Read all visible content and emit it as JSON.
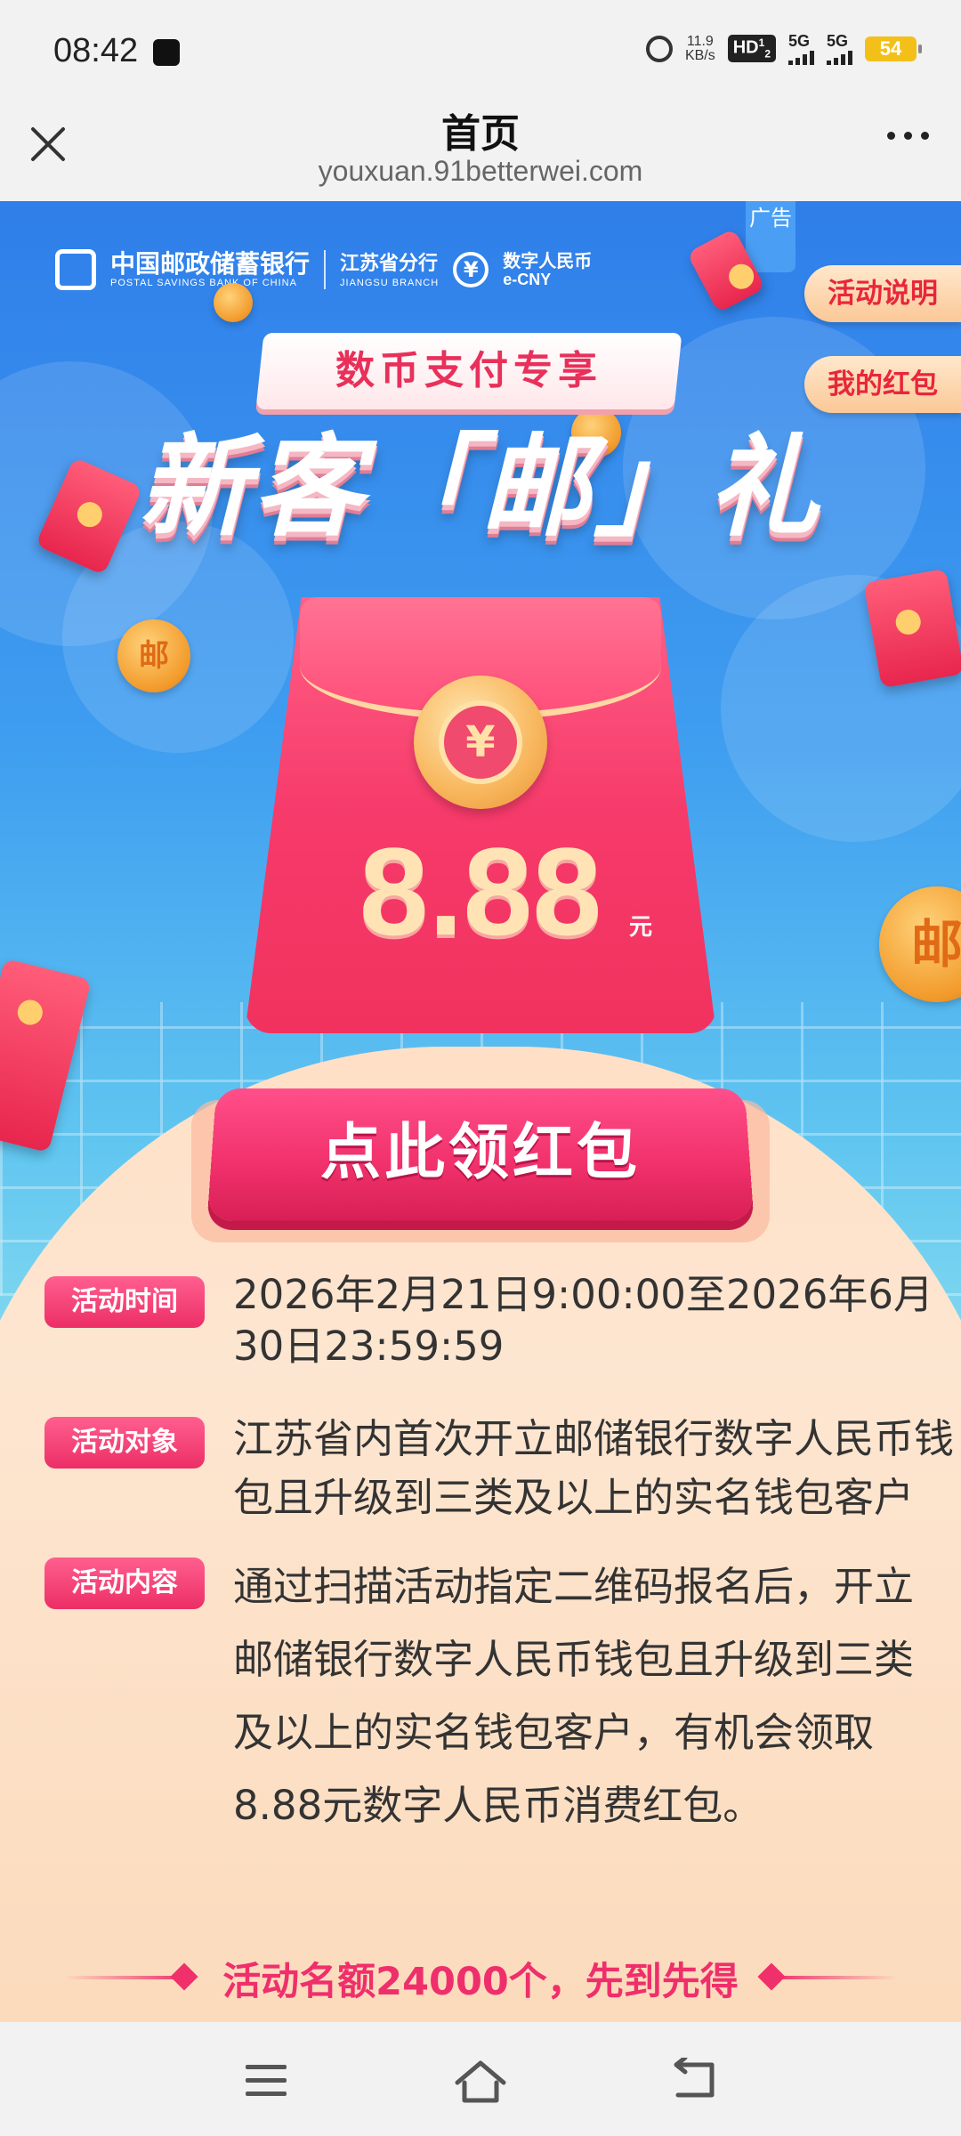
{
  "status_bar": {
    "time": "08:42",
    "net_speed_value": "11.9",
    "net_speed_unit": "KB/s",
    "hd_badge": "HD",
    "hd_sub": "1",
    "hd_sub2": "2",
    "signal1": "5G",
    "signal2": "5G",
    "battery": "54"
  },
  "header": {
    "title": "首页",
    "url": "youxuan.91betterwei.com"
  },
  "ad": {
    "ad_tag": "广告",
    "bank_name": "中国邮政储蓄银行",
    "bank_name_en": "POSTAL SAVINGS BANK OF CHINA",
    "branch": "江苏省分行",
    "branch_en": "JIANGSU BRANCH",
    "ecny_label": "数字人民币",
    "ecny_en": "e-CNY",
    "side_buttons": [
      "活动说明",
      "我的红包"
    ],
    "ribbon": "数币支付专享",
    "headline": "新客「邮」礼",
    "coin_label": "邮",
    "envelope_symbol": "¥",
    "amount": "8.88",
    "amount_unit": "元",
    "cta": "点此领红包",
    "info": [
      {
        "tag": "活动时间",
        "text": "2026年2月21日9:00:00至2026年6月30日23:59:59"
      },
      {
        "tag": "活动对象",
        "text": "江苏省内首次开立邮储银行数字人民币钱包且升级到三类及以上的实名钱包客户"
      },
      {
        "tag": "活动内容",
        "text": "通过扫描活动指定二维码报名后，开立邮储银行数字人民币钱包且升级到三类及以上的实名钱包客户，有机会领取8.88元数字人民币消费红包。"
      }
    ],
    "footer": "活动名额24000个，先到先得"
  },
  "colors": {
    "brand_red": "#f0306b",
    "sky_blue": "#3f9ef0",
    "accent_gold": "#ffd27a"
  },
  "nav": {
    "icons": [
      "menu-icon",
      "home-icon",
      "back-icon"
    ]
  }
}
